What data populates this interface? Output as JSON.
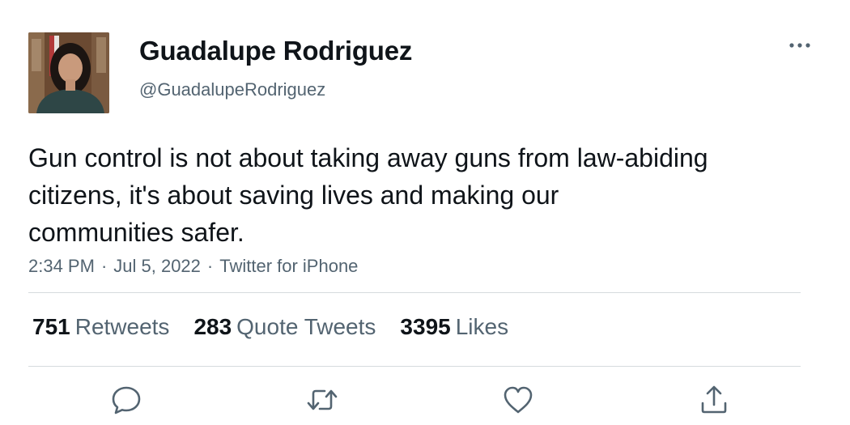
{
  "tweet": {
    "author": {
      "display_name": "Guadalupe Rodriguez",
      "handle": "@GuadalupeRodriguez",
      "avatar_icon": "profile-photo"
    },
    "text": "Gun control is not about taking away guns from law-abiding citizens, it's about saving lives and making our communities safer.",
    "meta": {
      "time": "2:34 PM",
      "date": "Jul 5, 2022",
      "source": "Twitter for iPhone",
      "separator": "·"
    },
    "stats": {
      "retweets": {
        "count": "751",
        "label": "Retweets"
      },
      "quotes": {
        "count": "283",
        "label": "Quote Tweets"
      },
      "likes": {
        "count": "3395",
        "label": "Likes"
      }
    },
    "actions": [
      "reply-icon",
      "retweet-icon",
      "like-icon",
      "share-icon"
    ],
    "more_icon": "more-icon"
  },
  "colors": {
    "text": "#0f1419",
    "secondary": "#536471",
    "divider": "#d6dbde"
  }
}
